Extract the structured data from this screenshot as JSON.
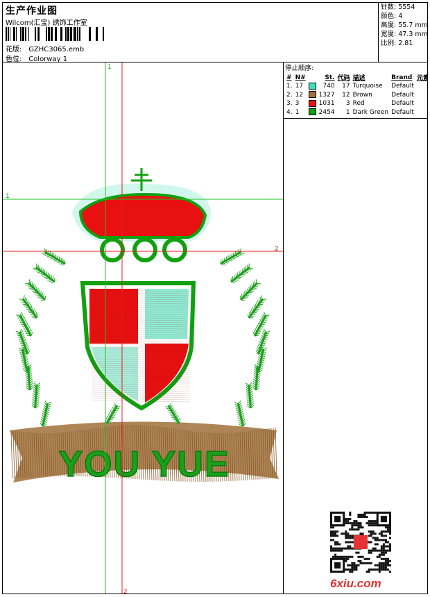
{
  "header": {
    "title": "生产作业图",
    "company": "Wilcom(汇宝) 绣饰工作室",
    "design_label": "花版:",
    "design_value": "GZHC3065.emb",
    "colorway_label": "色位:",
    "colorway_value": "Colorway 1"
  },
  "stats": {
    "stitches": "针数: 5554",
    "colors": "颜色: 4",
    "height": "高度: 55.7 mm",
    "width": "宽度: 47.3 mm",
    "scale": "比例: 2.81"
  },
  "stop_sequence": {
    "title": "停止顺序:",
    "headers": [
      "#",
      "N#",
      "St.",
      "代码",
      "描述",
      "Brand",
      "元素"
    ],
    "rows": [
      {
        "idx": "1.",
        "n": "17",
        "color": "#40e0b8",
        "st": "740",
        "code": "17",
        "desc": "Turquoise",
        "brand": "Default"
      },
      {
        "idx": "2.",
        "n": "12",
        "color": "#a0703a",
        "st": "1327",
        "code": "12",
        "desc": "Brown",
        "brand": "Default"
      },
      {
        "idx": "3.",
        "n": "3",
        "color": "#e81010",
        "st": "1031",
        "code": "3",
        "desc": "Red",
        "brand": "Default"
      },
      {
        "idx": "4.",
        "n": "1",
        "color": "#10a010",
        "st": "2454",
        "code": "1",
        "desc": "Dark Green",
        "brand": "Default"
      }
    ]
  },
  "guides": {
    "v1_label": "1",
    "h1_label": "1",
    "h2_label": "2",
    "v2_label": "2"
  },
  "design_text": "YOU YUE",
  "watermark": "6xiu.com",
  "colors": {
    "turquoise": "#40e0b8",
    "brown": "#a0703a",
    "red": "#e81010",
    "green": "#10a010",
    "guide_green": "#22c022",
    "guide_red": "#e02020"
  }
}
